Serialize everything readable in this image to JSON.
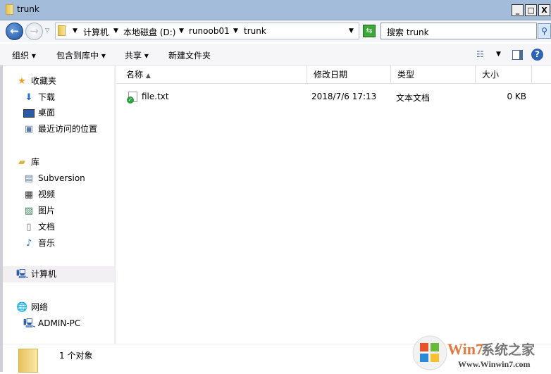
{
  "window": {
    "title": "trunk",
    "minimize": "_",
    "maximize": "□",
    "close": "X"
  },
  "address": {
    "crumbs": [
      "计算机",
      "本地磁盘 (D:)",
      "runoob01",
      "trunk"
    ]
  },
  "search": {
    "placeholder": "搜索 trunk"
  },
  "toolbar": {
    "organize": "组织 ▾",
    "include_library": "包含到库中 ▾",
    "share": "共享 ▾",
    "new_folder": "新建文件夹"
  },
  "nav": {
    "favorites": {
      "label": "收藏夹",
      "items": [
        "下载",
        "桌面",
        "最近访问的位置"
      ]
    },
    "libraries": {
      "label": "库",
      "items": [
        "Subversion",
        "视频",
        "图片",
        "文档",
        "音乐"
      ]
    },
    "computer": "计算机",
    "network": {
      "label": "网络",
      "items": [
        "ADMIN-PC"
      ]
    }
  },
  "columns": {
    "name": "名称",
    "modified": "修改日期",
    "type": "类型",
    "size": "大小"
  },
  "files": [
    {
      "name": "file.txt",
      "modified": "2018/7/6 17:13",
      "type": "文本文档",
      "size": "0 KB"
    }
  ],
  "status": {
    "count": "1 个对象"
  },
  "watermark": {
    "brand": "Win7系统之家",
    "url": "Www.Winwin7.com"
  }
}
